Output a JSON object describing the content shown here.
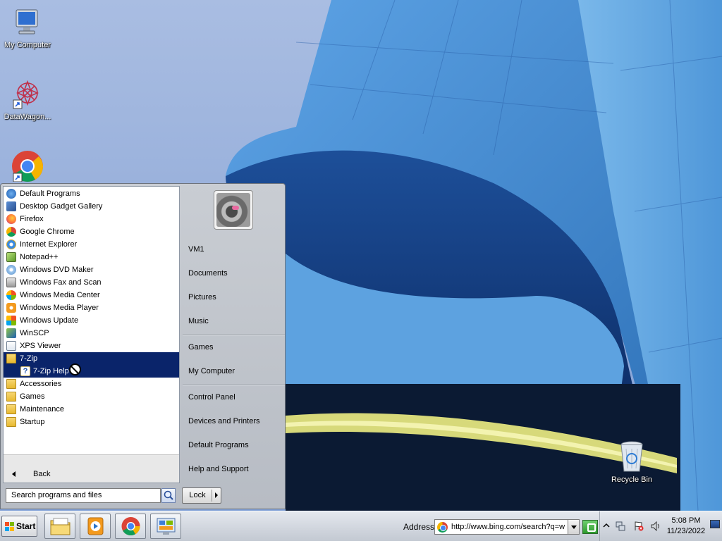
{
  "desktop": {
    "icons": [
      {
        "label": "My Computer",
        "icon": "computer-icon"
      },
      {
        "label": "DataWagon...",
        "icon": "datawagon-shortcut-icon"
      },
      {
        "label": "",
        "icon": "chrome-shortcut-icon"
      },
      {
        "label": "Recycle Bin",
        "icon": "recycle-bin-icon"
      }
    ]
  },
  "start_menu": {
    "programs": [
      {
        "label": "Default Programs",
        "icon": "default-programs-icon"
      },
      {
        "label": "Desktop Gadget Gallery",
        "icon": "gadget-gallery-icon"
      },
      {
        "label": "Firefox",
        "icon": "firefox-icon"
      },
      {
        "label": "Google Chrome",
        "icon": "chrome-icon"
      },
      {
        "label": "Internet Explorer",
        "icon": "internet-explorer-icon"
      },
      {
        "label": "Notepad++",
        "icon": "notepadpp-icon"
      },
      {
        "label": "Windows DVD Maker",
        "icon": "dvd-maker-icon"
      },
      {
        "label": "Windows Fax and Scan",
        "icon": "fax-scan-icon"
      },
      {
        "label": "Windows Media Center",
        "icon": "media-center-icon"
      },
      {
        "label": "Windows Media Player",
        "icon": "media-player-icon"
      },
      {
        "label": "Windows Update",
        "icon": "windows-update-icon"
      },
      {
        "label": "WinSCP",
        "icon": "winscp-icon"
      },
      {
        "label": "XPS Viewer",
        "icon": "xps-viewer-icon"
      }
    ],
    "folders": [
      {
        "label": "7-Zip",
        "icon": "folder-icon",
        "selected": true
      },
      {
        "label": "7-Zip Help",
        "icon": "help-file-icon",
        "selected": true,
        "child": true
      },
      {
        "label": "Accessories",
        "icon": "folder-icon"
      },
      {
        "label": "Games",
        "icon": "folder-icon"
      },
      {
        "label": "Maintenance",
        "icon": "folder-icon"
      },
      {
        "label": "Startup",
        "icon": "folder-icon"
      }
    ],
    "back_label": "Back",
    "search_placeholder": "Search programs and files",
    "right_items": [
      {
        "label": "VM1"
      },
      {
        "label": "Documents"
      },
      {
        "label": "Pictures"
      },
      {
        "label": "Music"
      },
      {
        "label": "Games"
      },
      {
        "label": "My Computer"
      },
      {
        "label": "Control Panel"
      },
      {
        "label": "Devices and Printers"
      },
      {
        "label": "Default Programs"
      },
      {
        "label": "Help and Support"
      }
    ],
    "lock_label": "Lock"
  },
  "taskbar": {
    "start_label": "Start",
    "pinned": [
      {
        "name": "explorer-taskbar-button",
        "icon": "folder-icon"
      },
      {
        "name": "media-player-taskbar-button",
        "icon": "media-player-icon"
      },
      {
        "name": "chrome-taskbar-button",
        "icon": "chrome-icon"
      },
      {
        "name": "control-panel-taskbar-button",
        "icon": "control-panel-icon"
      }
    ],
    "address_label": "Address",
    "address_value": "http://www.bing.com/search?q=w",
    "time": "5:08 PM",
    "date": "11/23/2022"
  },
  "colors": {
    "selection": "#0a246a",
    "sky": "#93acd9",
    "building": "#3f86cf"
  }
}
